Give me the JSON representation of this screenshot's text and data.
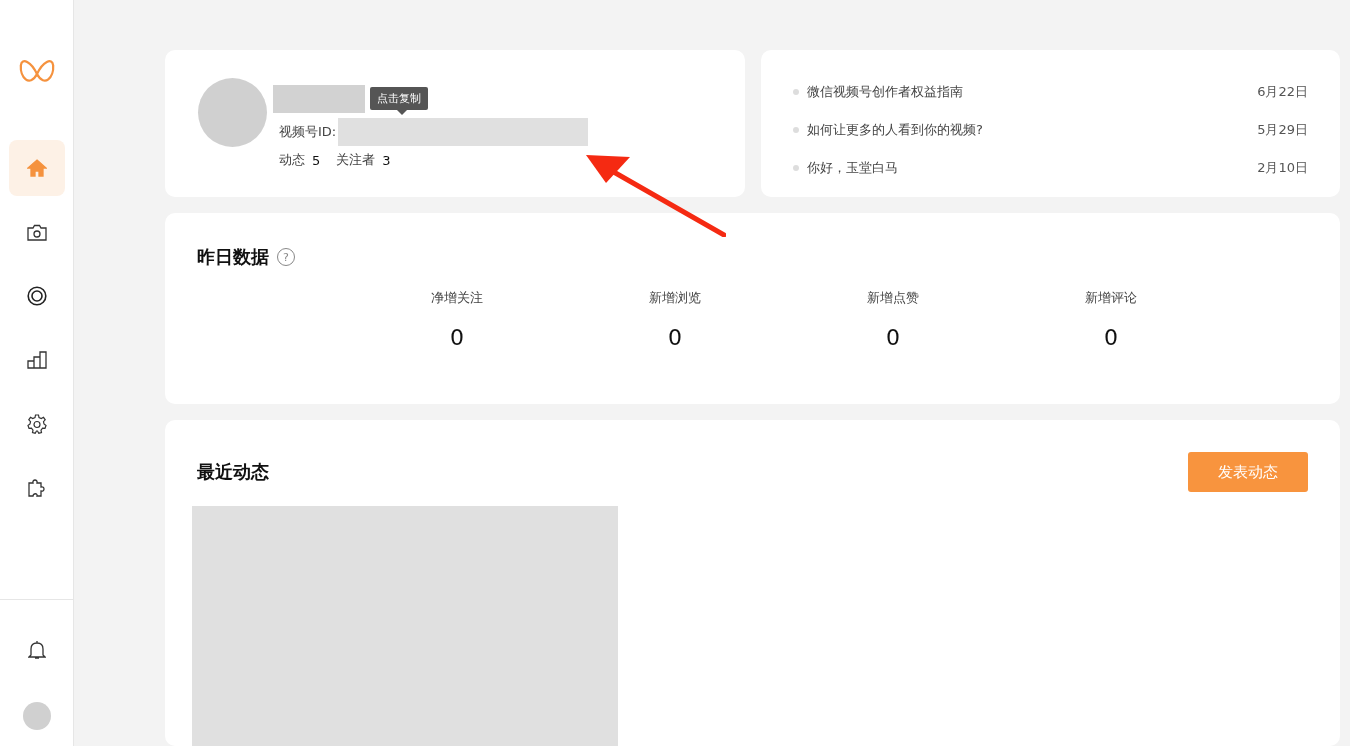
{
  "sidebar": {
    "items": [
      {
        "selected": true
      },
      {
        "selected": false
      },
      {
        "selected": false
      },
      {
        "selected": false
      },
      {
        "selected": false
      },
      {
        "selected": false
      }
    ]
  },
  "profile": {
    "id_label": "视频号ID:",
    "tooltip": "点击复制",
    "stats": [
      {
        "label": "动态",
        "value": "5"
      },
      {
        "label": "关注者",
        "value": "3"
      }
    ]
  },
  "news": [
    {
      "title": "微信视频号创作者权益指南",
      "date": "6月22日"
    },
    {
      "title": "如何让更多的人看到你的视频?",
      "date": "5月29日"
    },
    {
      "title": "你好，玉堂白马",
      "date": "2月10日"
    }
  ],
  "yesterday": {
    "title": "昨日数据",
    "help": "?",
    "metrics": [
      {
        "label": "净增关注",
        "value": "0"
      },
      {
        "label": "新增浏览",
        "value": "0"
      },
      {
        "label": "新增点赞",
        "value": "0"
      },
      {
        "label": "新增评论",
        "value": "0"
      }
    ]
  },
  "recent": {
    "title": "最近动态",
    "button": "发表动态"
  }
}
